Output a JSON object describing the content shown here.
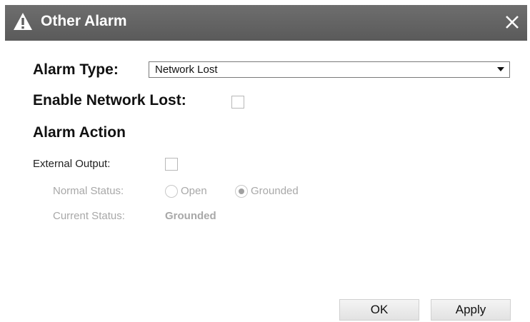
{
  "dialog": {
    "title": "Other Alarm",
    "title_bar_color": "#636363"
  },
  "alarm_type": {
    "label": "Alarm Type:",
    "selected": "Network Lost"
  },
  "enable": {
    "label": "Enable Network Lost:",
    "checked": false
  },
  "alarm_action": {
    "heading": "Alarm Action",
    "external_output_label": "External Output:",
    "external_output_checked": false,
    "normal_status_label": "Normal Status:",
    "normal_status_options": [
      "Open",
      "Grounded"
    ],
    "normal_status_selected": "Grounded",
    "current_status_label": "Current Status:",
    "current_status_value": "Grounded"
  },
  "buttons": {
    "ok": "OK",
    "apply": "Apply"
  },
  "icons": {
    "title": "warning-icon",
    "close": "close-icon"
  }
}
